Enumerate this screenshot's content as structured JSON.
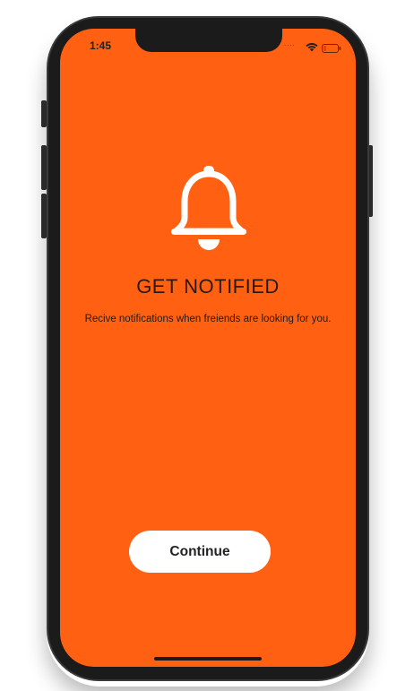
{
  "status_bar": {
    "time": "1:45",
    "signal_icon": "signal-dots-icon",
    "wifi_icon": "wifi-icon",
    "battery_icon": "battery-low-icon"
  },
  "onboarding": {
    "icon": "bell-icon",
    "title": "GET NOTIFIED",
    "description": "Recive notifications when freiends are looking for you.",
    "continue_label": "Continue"
  },
  "colors": {
    "background": "#ff6012",
    "button": "#ffffff",
    "text": "#2a1a10",
    "battery_low": "#e53935"
  }
}
